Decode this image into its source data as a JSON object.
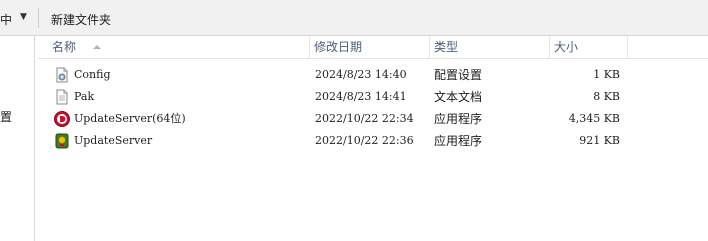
{
  "toolbar": {
    "partial_label": "中",
    "dropdown_glyph": "▼",
    "new_folder_label": "新建文件夹"
  },
  "nav": {
    "partial_item": "置"
  },
  "columns": {
    "name": "名称",
    "date": "修改日期",
    "type": "类型",
    "size": "大小"
  },
  "files": [
    {
      "name": "Config",
      "date": "2024/8/23 14:40",
      "type": "配置设置",
      "size": "1 KB",
      "icon": "config-file-icon"
    },
    {
      "name": "Pak",
      "date": "2024/8/23 14:41",
      "type": "文本文档",
      "size": "8 KB",
      "icon": "text-file-icon"
    },
    {
      "name": "UpdateServer(64位)",
      "date": "2022/10/22 22:34",
      "type": "应用程序",
      "size": "4,345 KB",
      "icon": "red-app-icon"
    },
    {
      "name": "UpdateServer",
      "date": "2022/10/22 22:36",
      "type": "应用程序",
      "size": "921 KB",
      "icon": "green-app-icon"
    }
  ],
  "colors": {
    "header_text": "#4c607a",
    "toolbar_bg": "#f1f1f1",
    "red_app": "#c8102e",
    "green_app": "#3c7d2a"
  }
}
